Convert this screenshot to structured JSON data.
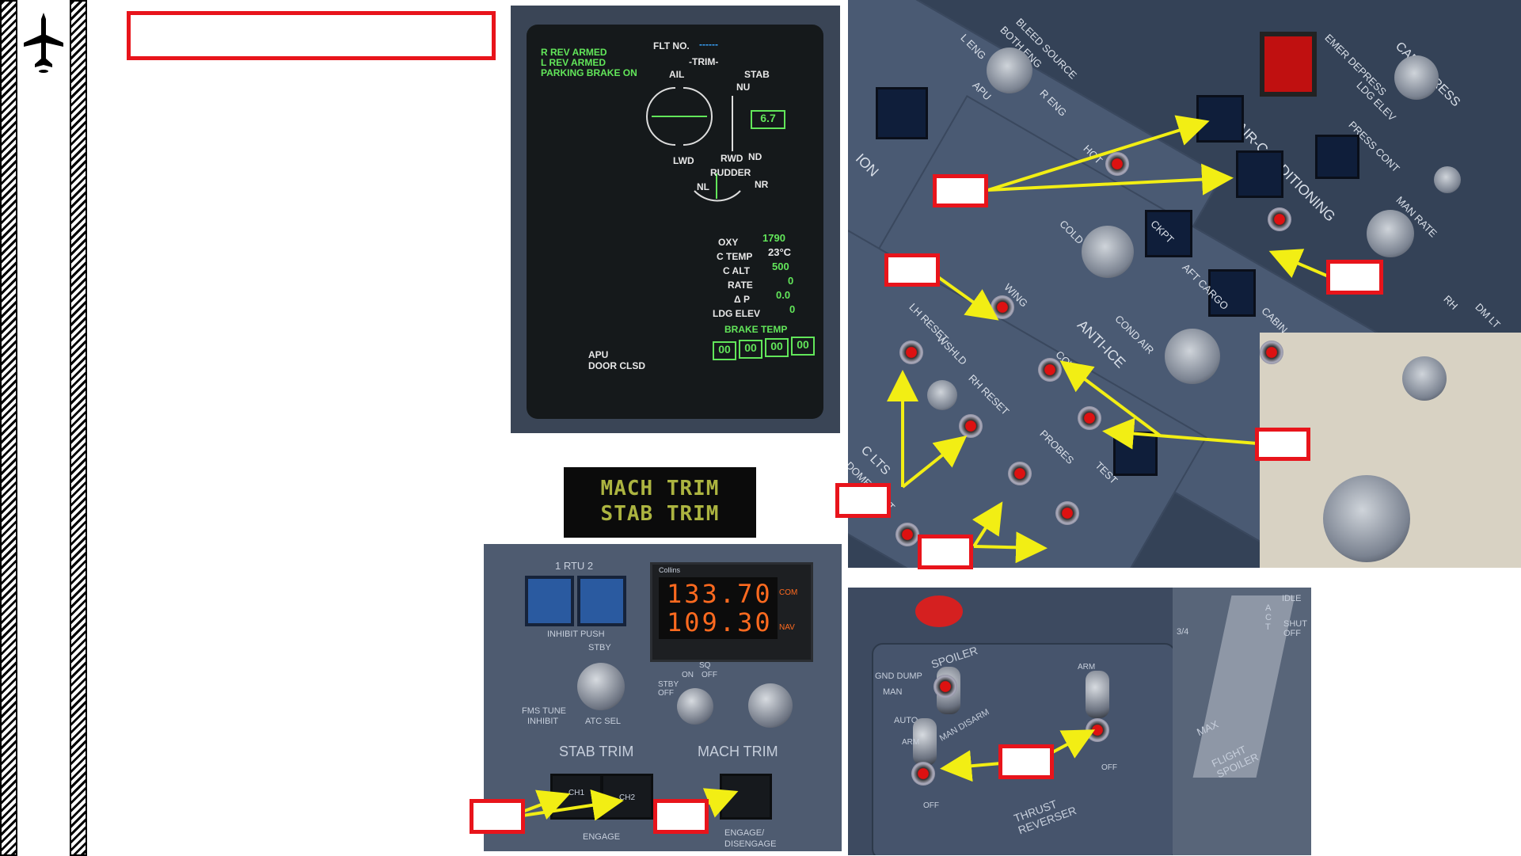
{
  "eicas": {
    "msg1": "R REV ARMED",
    "msg2": "L REV ARMED",
    "msg3": "PARKING BRAKE ON",
    "flt_no": "FLT NO.",
    "flt_no_value": "------",
    "trim": "-TRIM-",
    "ail": "AIL",
    "stab": "STAB",
    "nu": "NU",
    "nd": "ND",
    "stab_value": "6.7",
    "lwd": "LWD",
    "rwd": "RWD",
    "rudder": "RUDDER",
    "nl": "NL",
    "nr": "NR",
    "oxy_label": "OXY",
    "oxy_value": "1790",
    "ctemp_label": "C TEMP",
    "ctemp_value": "23°C",
    "calt_label": "C ALT",
    "calt_value": "500",
    "rate_label": "RATE",
    "rate_value": "0",
    "dp_label": "Δ P",
    "dp_value": "0.0",
    "ldgelev_label": "LDG ELEV",
    "ldgelev_value": "0",
    "brake_temp": "BRAKE TEMP",
    "brake_values": [
      "00",
      "00",
      "00",
      "00"
    ],
    "apu": "APU",
    "apu_door": "DOOR CLSD"
  },
  "annunciator": {
    "line1": "MACH TRIM",
    "line2": "STAB TRIM"
  },
  "rtu": {
    "title": "1 RTU 2",
    "inhibit_push": "INHIBIT PUSH",
    "stby": "STBY",
    "fms_tune": "FMS TUNE",
    "inhibit": "INHIBIT",
    "atc_sel": "ATC SEL",
    "radio_brand": "Collins",
    "com_freq": "133.70",
    "nav_freq": "109.30",
    "com": "COM",
    "nav": "NAV",
    "sq": "SQ",
    "on": "ON",
    "off": "OFF",
    "stby_off": "STBY OFF",
    "stab_trim": "STAB TRIM",
    "mach_trim": "MACH TRIM",
    "ch1": "CH1",
    "ch2": "CH2",
    "engage": "ENGAGE",
    "engage_disengage": "ENGAGE/ DISENGAGE"
  },
  "overhead": {
    "bleed_source": "BLEED SOURCE",
    "both_eng": "BOTH ENG",
    "l_eng": "L ENG",
    "apu": "APU",
    "r_eng": "R ENG",
    "air_conditioning": "AIR-CONDITIONING",
    "cabin_press": "CABIN PRESS",
    "emer_depress": "EMER DEPRESS",
    "anti_ice": "ANTI-ICE",
    "wing": "WING",
    "wshld": "WSHLD",
    "lh_reset": "LH RESET",
    "rh_reset": "RH RESET",
    "cowl": "COWL",
    "probes": "PROBES",
    "test": "TEST",
    "hot": "HOT",
    "cold": "COLD",
    "cond_air": "COND AIR",
    "aft_cargo": "AFT CARGO",
    "cabin": "CABIN",
    "cdpt": "CKPT",
    "ldg_elev": "LDG ELEV",
    "press_cont": "PRESS CONT",
    "man_rate": "MAN RATE",
    "rh": "RH",
    "dm_lt": "DM LT",
    "c_lts": "C LTS",
    "dome_light": "DOME LIGHT",
    "ion": "ION"
  },
  "thrust": {
    "spoiler": "SPOILER",
    "gnd_dump": "GND DUMP",
    "man": "MAN",
    "auto": "AUTO",
    "man_disarm": "MAN DISARM",
    "thrust_reverser": "THRUST REVERSER",
    "arm": "ARM",
    "off": "OFF",
    "flight_spoiler": "FLIGHT SPOILER",
    "max": "MAX",
    "idle": "IDLE",
    "shut_off": "SHUT OFF",
    "act": "A C T",
    "detent": "3/4"
  },
  "colors": {
    "callout_red": "#e8141b",
    "arrow_yellow": "#f2ee14",
    "eicas_green": "#62e65a",
    "radio_orange": "#ff6a1f"
  }
}
